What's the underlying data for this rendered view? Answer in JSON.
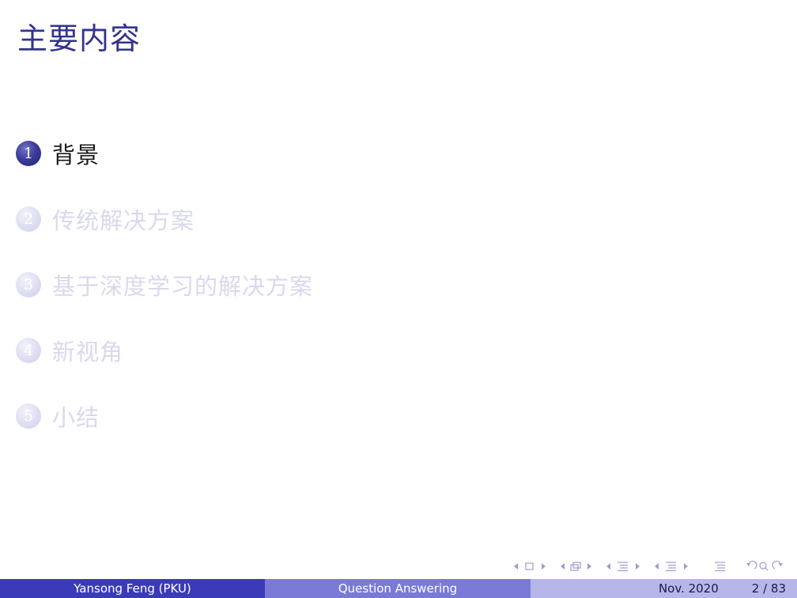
{
  "slide": {
    "title": "主要内容"
  },
  "toc": {
    "items": [
      {
        "number": "1",
        "label": "背景",
        "state": "active"
      },
      {
        "number": "2",
        "label": "传统解决方案",
        "state": "inactive"
      },
      {
        "number": "3",
        "label": "基于深度学习的解决方案",
        "state": "inactive"
      },
      {
        "number": "4",
        "label": "新视角",
        "state": "inactive"
      },
      {
        "number": "5",
        "label": "小结",
        "state": "inactive"
      }
    ]
  },
  "footer": {
    "author": "Yansong Feng  (PKU)",
    "talk_title": "Question Answering",
    "date": "Nov. 2020",
    "page": "2 / 83"
  },
  "colors": {
    "title": "#33338f",
    "footer_left": "#3b3bb8",
    "footer_mid": "#7a7ad6",
    "footer_right": "#b6b6ea",
    "nav_icons": "#9c9cd0"
  },
  "nav_icons": [
    "frame-prev-icon",
    "frame-icon",
    "frame-next-icon",
    "subsection-prev-icon",
    "subsection-icon",
    "subsection-next-icon",
    "section-prev-icon",
    "section-icon",
    "section-next-icon",
    "subsection-prev-icon",
    "subsection-icon",
    "subsection-next-icon",
    "appendix-icon",
    "back-icon",
    "search-icon",
    "forward-icon"
  ]
}
